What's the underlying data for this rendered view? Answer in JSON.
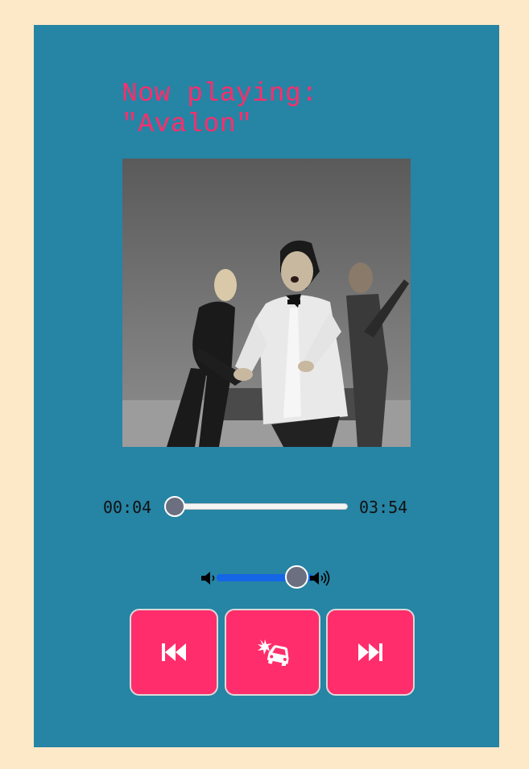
{
  "player": {
    "title_line1": "Now playing:",
    "title_line2": "\"Avalon\"",
    "accent_color": "#ff2d6b",
    "panel_color": "#2684a4",
    "background_color": "#fde8c8"
  },
  "album_art": {
    "description_icon": "album-cover-photo"
  },
  "seek": {
    "current_time": "00:04",
    "total_time": "03:54",
    "progress_fraction": 0.017
  },
  "volume": {
    "level_fraction": 0.72,
    "low_icon": "volume-low-icon",
    "high_icon": "volume-high-icon"
  },
  "controls": {
    "prev_icon": "skip-back-icon",
    "middle_icon": "car-crash-icon",
    "next_icon": "skip-forward-icon"
  }
}
